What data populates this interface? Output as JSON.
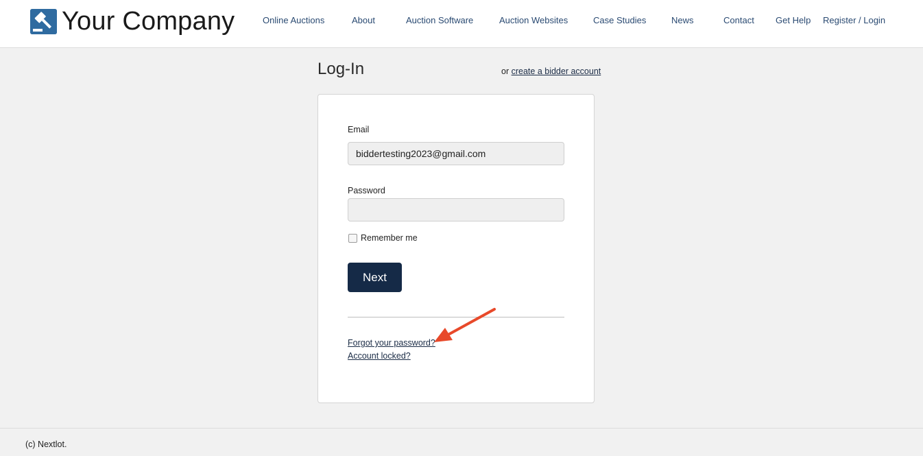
{
  "header": {
    "logo_text": "Your Company",
    "nav": [
      {
        "label": "Online Auctions"
      },
      {
        "label": "About"
      },
      {
        "label": "Auction Software"
      },
      {
        "label": "Auction Websites"
      },
      {
        "label": "Case Studies"
      },
      {
        "label": "News"
      },
      {
        "label": "Contact"
      },
      {
        "label": "Get Help"
      },
      {
        "label": "Register / Login"
      }
    ]
  },
  "main": {
    "title": "Log-In",
    "alt_prefix": "or",
    "alt_link": "create a bidder account"
  },
  "form": {
    "email_label": "Email",
    "email_value": "biddertesting2023@gmail.com",
    "password_label": "Password",
    "password_value": "",
    "remember_label": "Remember me",
    "remember_checked": false,
    "next_label": "Next",
    "forgot_link": "Forgot your password?",
    "locked_link": "Account locked?"
  },
  "annotation": {
    "arrow_color": "#e8492a"
  },
  "footer": {
    "text": "(c) Nextlot."
  },
  "colors": {
    "brand_blue": "#2f6ba0",
    "button_navy": "#152a47",
    "nav_link": "#2a4a72",
    "page_bg": "#f1f1f1"
  }
}
